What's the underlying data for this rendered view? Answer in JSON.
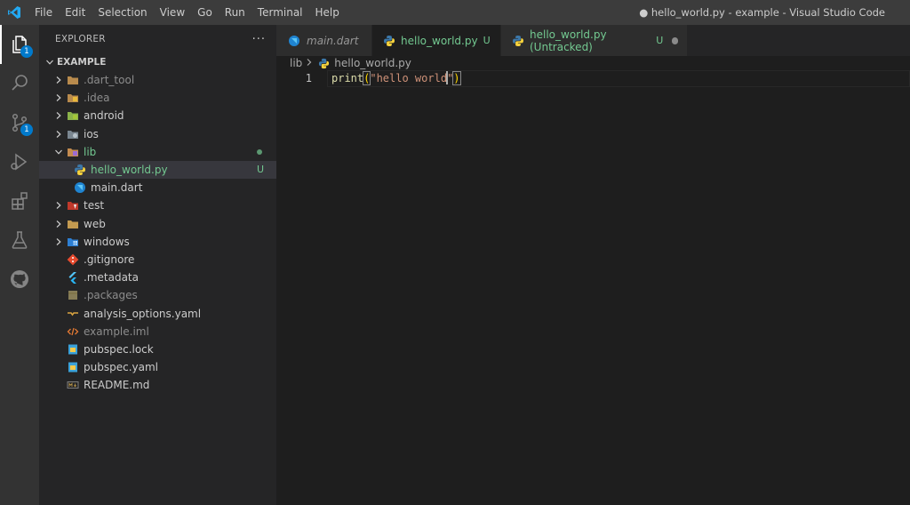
{
  "titlebar": {
    "menu": [
      "File",
      "Edit",
      "Selection",
      "View",
      "Go",
      "Run",
      "Terminal",
      "Help"
    ],
    "window_title": "● hello_world.py - example - Visual Studio Code"
  },
  "activitybar": {
    "items": [
      {
        "icon": "files-icon",
        "badge": "1"
      },
      {
        "icon": "search-icon",
        "badge": ""
      },
      {
        "icon": "source-control-icon",
        "badge": "1"
      },
      {
        "icon": "run-debug-icon",
        "badge": ""
      },
      {
        "icon": "extensions-icon",
        "badge": ""
      },
      {
        "icon": "testing-icon",
        "badge": ""
      },
      {
        "icon": "github-icon",
        "badge": ""
      }
    ]
  },
  "sidebar": {
    "title": "EXPLORER",
    "more": "···",
    "section": "EXAMPLE",
    "tree": [
      {
        "label": ".dart_tool",
        "icon": "folder-icon",
        "dim": true
      },
      {
        "label": ".idea",
        "icon": "folder-icon",
        "dim": true
      },
      {
        "label": "android",
        "icon": "android-folder-icon"
      },
      {
        "label": "ios",
        "icon": "ios-folder-icon"
      },
      {
        "label": "lib",
        "icon": "lib-folder-icon",
        "dot": true
      },
      {
        "label": "hello_world.py",
        "icon": "python-icon",
        "decoration": "U"
      },
      {
        "label": "main.dart",
        "icon": "dart-icon"
      },
      {
        "label": "test",
        "icon": "test-folder-icon"
      },
      {
        "label": "web",
        "icon": "folder-icon"
      },
      {
        "label": "windows",
        "icon": "windows-folder-icon"
      },
      {
        "label": ".gitignore",
        "icon": "git-icon"
      },
      {
        "label": ".metadata",
        "icon": "flutter-icon"
      },
      {
        "label": ".packages",
        "icon": "packages-icon",
        "dim": true
      },
      {
        "label": "analysis_options.yaml",
        "icon": "yaml-icon"
      },
      {
        "label": "example.iml",
        "icon": "xml-icon",
        "dim": true
      },
      {
        "label": "pubspec.lock",
        "icon": "pubspec-icon"
      },
      {
        "label": "pubspec.yaml",
        "icon": "pubspec-icon"
      },
      {
        "label": "README.md",
        "icon": "markdown-icon"
      }
    ]
  },
  "tabs": [
    {
      "label": "main.dart",
      "icon": "dart-icon"
    },
    {
      "label": "hello_world.py",
      "icon": "python-icon",
      "status": "U"
    },
    {
      "label": "hello_world.py (Untracked)",
      "icon": "python-icon",
      "status": "U"
    }
  ],
  "breadcrumb": {
    "folder": "lib",
    "file": "hello_world.py"
  },
  "editor": {
    "line_number": "1",
    "tokens": {
      "fn": "print",
      "open": "(",
      "str_a": "\"hello world",
      "str_b": "\"",
      "close": ")"
    }
  },
  "colors": {
    "accent": "#007acc",
    "untracked": "#73c991",
    "bracket": "#ffd700"
  }
}
